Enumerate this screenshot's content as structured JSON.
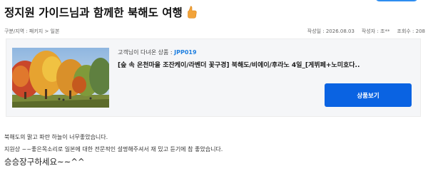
{
  "post": {
    "title": "정지원 가이드님과 함께한 북해도 여행"
  },
  "breadcrumb": "구분/지역 : 패키지 > 일본",
  "meta": {
    "date": "작성일 : 2026.08.03",
    "author": "작성자 : 조**",
    "views": "조회수 : 208"
  },
  "product": {
    "visit_label": "고객님이 다녀온 상품 : ",
    "code": "JPP019",
    "name": "[숲 속 온천마을 조잔케이/라벤더 꽃구경] 북해도/비에이/후라노 4일_[게뷔페+노미호다..",
    "cta_label": "상품보기"
  },
  "body": {
    "line1": "북해도의 맑고 파란 하늘이 너무좋았습니다.",
    "line2": "지원상 ~~좋은목소리로 일본에 대한 전문적인 설명해주셔서 재 밌고 듣기에 참 좋았습니다.",
    "line3": "승승장구하세요~~^^"
  },
  "colors": {
    "accent": "#0a63e2",
    "code": "#1e7fe0"
  }
}
